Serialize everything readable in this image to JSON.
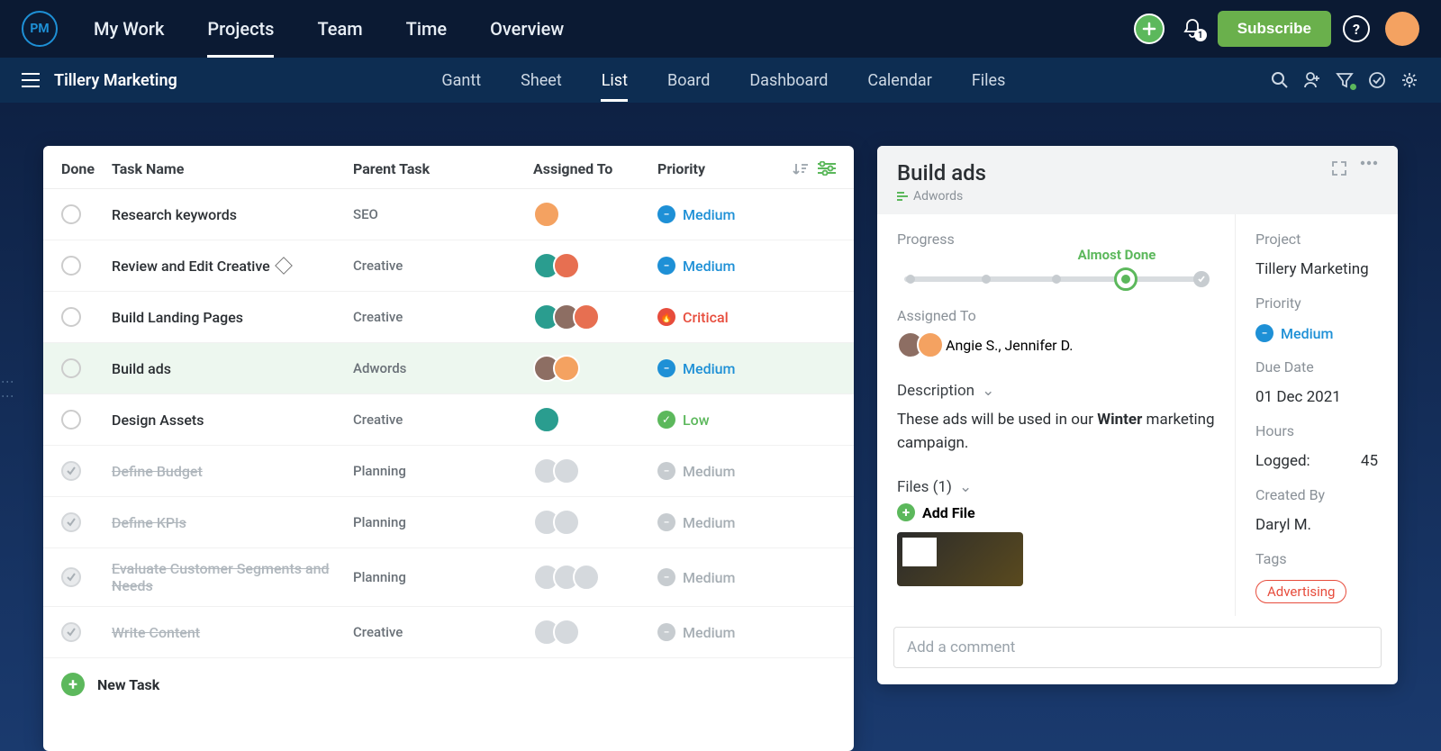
{
  "topnav": {
    "items": [
      "My Work",
      "Projects",
      "Team",
      "Time",
      "Overview"
    ],
    "active_index": 1,
    "subscribe_label": "Subscribe",
    "notification_count": "1"
  },
  "subnav": {
    "project_name": "Tillery Marketing",
    "tabs": [
      "Gantt",
      "Sheet",
      "List",
      "Board",
      "Dashboard",
      "Calendar",
      "Files"
    ],
    "active_index": 2
  },
  "list": {
    "headers": {
      "done": "Done",
      "name": "Task Name",
      "parent": "Parent Task",
      "assigned": "Assigned To",
      "priority": "Priority"
    },
    "rows": [
      {
        "name": "Research keywords",
        "parent": "SEO",
        "priority": "Medium",
        "done": false,
        "milestone": false,
        "avatars": [
          "av1"
        ]
      },
      {
        "name": "Review and Edit Creative",
        "parent": "Creative",
        "priority": "Medium",
        "done": false,
        "milestone": true,
        "avatars": [
          "av2",
          "av3"
        ]
      },
      {
        "name": "Build Landing Pages",
        "parent": "Creative",
        "priority": "Critical",
        "done": false,
        "milestone": false,
        "avatars": [
          "av2",
          "av4",
          "av3"
        ]
      },
      {
        "name": "Build ads",
        "parent": "Adwords",
        "priority": "Medium",
        "done": false,
        "milestone": false,
        "avatars": [
          "av4",
          "av1"
        ],
        "selected": true
      },
      {
        "name": "Design Assets",
        "parent": "Creative",
        "priority": "Low",
        "done": false,
        "milestone": false,
        "avatars": [
          "av2"
        ]
      },
      {
        "name": "Define Budget",
        "parent": "Planning",
        "priority": "Medium",
        "done": true,
        "milestone": false,
        "avatars": [
          "av-gray",
          "av-gray"
        ]
      },
      {
        "name": "Define KPIs",
        "parent": "Planning",
        "priority": "Medium",
        "done": true,
        "milestone": false,
        "avatars": [
          "av-gray",
          "av-gray"
        ]
      },
      {
        "name": "Evaluate Customer Segments and Needs",
        "parent": "Planning",
        "priority": "Medium",
        "done": true,
        "milestone": false,
        "avatars": [
          "av-gray",
          "av-gray",
          "av-gray"
        ]
      },
      {
        "name": "Write Content",
        "parent": "Creative",
        "priority": "Medium",
        "done": true,
        "milestone": false,
        "avatars": [
          "av-gray",
          "av-gray"
        ]
      }
    ],
    "new_task_label": "New Task"
  },
  "detail": {
    "title": "Build ads",
    "subtitle": "Adwords",
    "progress": {
      "label": "Progress",
      "stage_label": "Almost Done",
      "stage_index": 3,
      "total_stages": 5
    },
    "assigned": {
      "label": "Assigned To",
      "names": "Angie S., Jennifer D."
    },
    "description": {
      "label": "Description",
      "text_before": "These ads will be used in our ",
      "text_bold": "Winter",
      "text_after": " marketing campaign."
    },
    "files": {
      "label": "Files (1)",
      "add_label": "Add File"
    },
    "right": {
      "project": {
        "label": "Project",
        "value": "Tillery Marketing"
      },
      "priority": {
        "label": "Priority",
        "value": "Medium"
      },
      "due_date": {
        "label": "Due Date",
        "value": "01 Dec 2021"
      },
      "hours": {
        "label": "Hours",
        "row_label": "Logged:",
        "value": "45"
      },
      "created_by": {
        "label": "Created By",
        "value": "Daryl M."
      },
      "tags": {
        "label": "Tags",
        "values": [
          "Advertising"
        ]
      }
    },
    "comment_placeholder": "Add a comment"
  }
}
